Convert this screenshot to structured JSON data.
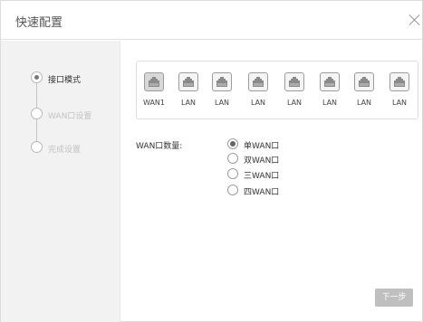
{
  "dialog": {
    "title": "快速配置"
  },
  "steps": [
    {
      "label": "接口模式",
      "state": "active"
    },
    {
      "label": "WAN口设置",
      "state": "inactive"
    },
    {
      "label": "完成设置",
      "state": "inactive"
    }
  ],
  "ports": [
    {
      "label": "WAN1",
      "state": "active"
    },
    {
      "label": "LAN",
      "state": "normal"
    },
    {
      "label": "LAN",
      "state": "normal"
    },
    {
      "label": "LAN",
      "state": "normal"
    },
    {
      "label": "LAN",
      "state": "normal"
    },
    {
      "label": "LAN",
      "state": "normal"
    },
    {
      "label": "LAN",
      "state": "normal"
    },
    {
      "label": "LAN",
      "state": "normal"
    }
  ],
  "wan_count": {
    "label": "WAN口数量:",
    "options": [
      {
        "label": "单WAN口",
        "checked": true
      },
      {
        "label": "双WAN口",
        "checked": false
      },
      {
        "label": "三WAN口",
        "checked": false
      },
      {
        "label": "四WAN口",
        "checked": false
      }
    ]
  },
  "footer": {
    "next_label": "下一步"
  },
  "icons": {
    "port": "ethernet-port-icon",
    "close": "close-icon"
  }
}
